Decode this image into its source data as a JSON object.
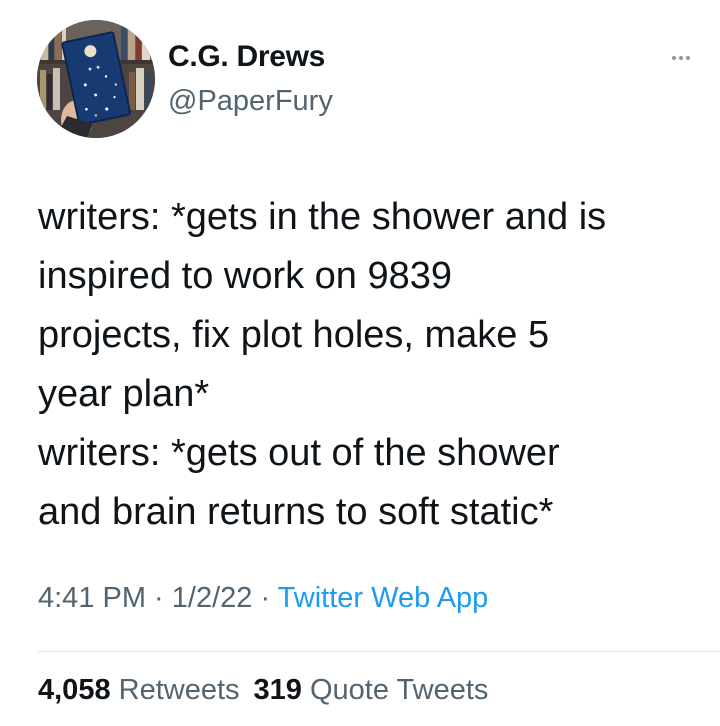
{
  "author": {
    "name": "C.G. Drews",
    "handle": "@PaperFury",
    "avatar_icon": "profile-photo-book"
  },
  "tweet": {
    "lines": [
      "writers: *gets in the shower and is",
      "inspired to work on 9839",
      "projects, fix plot holes, make 5",
      "year plan*",
      "writers: *gets out of the shower",
      "and brain returns to soft static*"
    ]
  },
  "meta": {
    "time": "4:41 PM",
    "separator": " · ",
    "date": "1/2/22",
    "source": "Twitter Web App"
  },
  "stats": {
    "retweets_count": "4,058",
    "retweets_label": "Retweets",
    "quotes_count": "319",
    "quotes_label": "Quote Tweets"
  },
  "colors": {
    "text": "#0f1419",
    "secondary": "#536471",
    "link": "#1d9bf0",
    "divider": "#dfe4e8"
  }
}
